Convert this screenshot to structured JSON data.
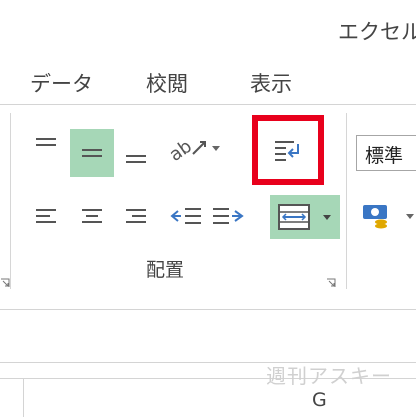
{
  "app_title": "エクセル",
  "tabs": [
    {
      "label": "データ"
    },
    {
      "label": "校閲"
    },
    {
      "label": "表示"
    }
  ],
  "ribbon": {
    "alignment_group_label": "配置",
    "number_format_value": "標準"
  },
  "column_headers": [
    "G"
  ],
  "watermark": "週刊アスキー",
  "colors": {
    "selected_button": "#a6d7b7",
    "highlight_box": "#e8001c",
    "icon_blue": "#3a76c4",
    "icon_gray": "#666666"
  }
}
